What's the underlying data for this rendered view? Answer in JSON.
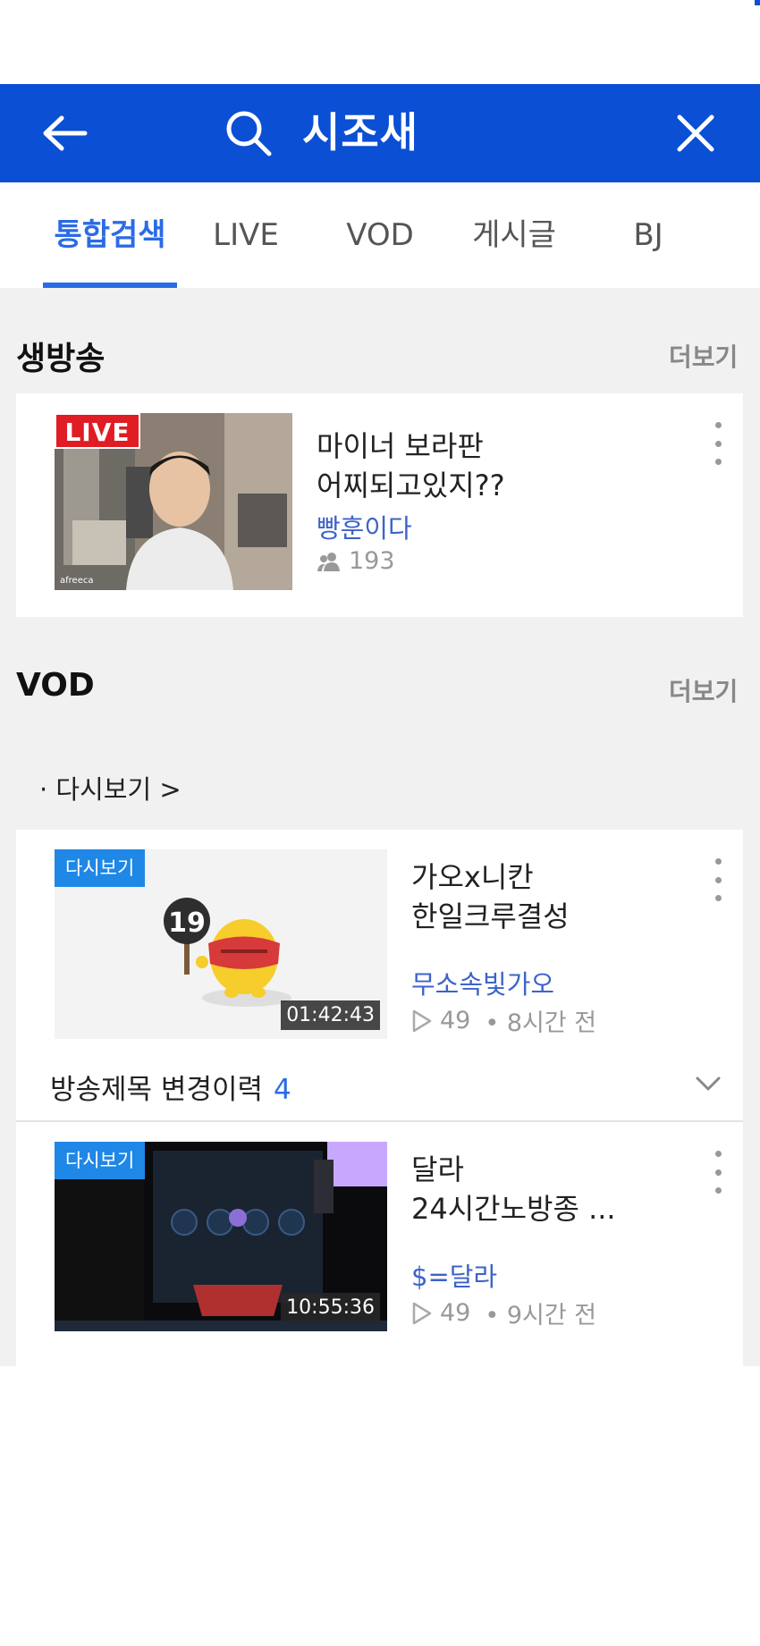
{
  "search": {
    "query": "시조새"
  },
  "tabs": [
    {
      "label": "통합검색",
      "active": true
    },
    {
      "label": "LIVE",
      "active": false
    },
    {
      "label": "VOD",
      "active": false
    },
    {
      "label": "게시글",
      "active": false
    },
    {
      "label": "BJ",
      "active": false
    }
  ],
  "live_section": {
    "title": "생방송",
    "more_label": "더보기",
    "item": {
      "badge": "LIVE",
      "title_line1": "마이너 보라판",
      "title_line2": "어찌되고있지??",
      "author": "빵훈이다",
      "viewers": "193"
    }
  },
  "vod_section": {
    "title": "VOD",
    "more_label": "더보기",
    "replay_link": "· 다시보기 >",
    "items": [
      {
        "badge": "다시보기",
        "duration": "01:42:43",
        "age_rating": "19",
        "title_line1": "가오x니칸",
        "title_line2": "한일크루결성",
        "author": "무소속빛가오",
        "views": "49",
        "time_ago": "• 8시간 전"
      },
      {
        "badge": "다시보기",
        "duration": "10:55:36",
        "title_line1": "달라",
        "title_line2": "24시간노방종 ...",
        "author": "$=달라",
        "views": "49",
        "time_ago": "• 9시간 전"
      }
    ],
    "history": {
      "label": "방송제목 변경이력",
      "count": "4"
    }
  },
  "colors": {
    "brand": "#0a4fd4",
    "accent": "#2a6be6",
    "live": "#e01c24",
    "replay": "#1f87e6",
    "author": "#3d63c9"
  }
}
